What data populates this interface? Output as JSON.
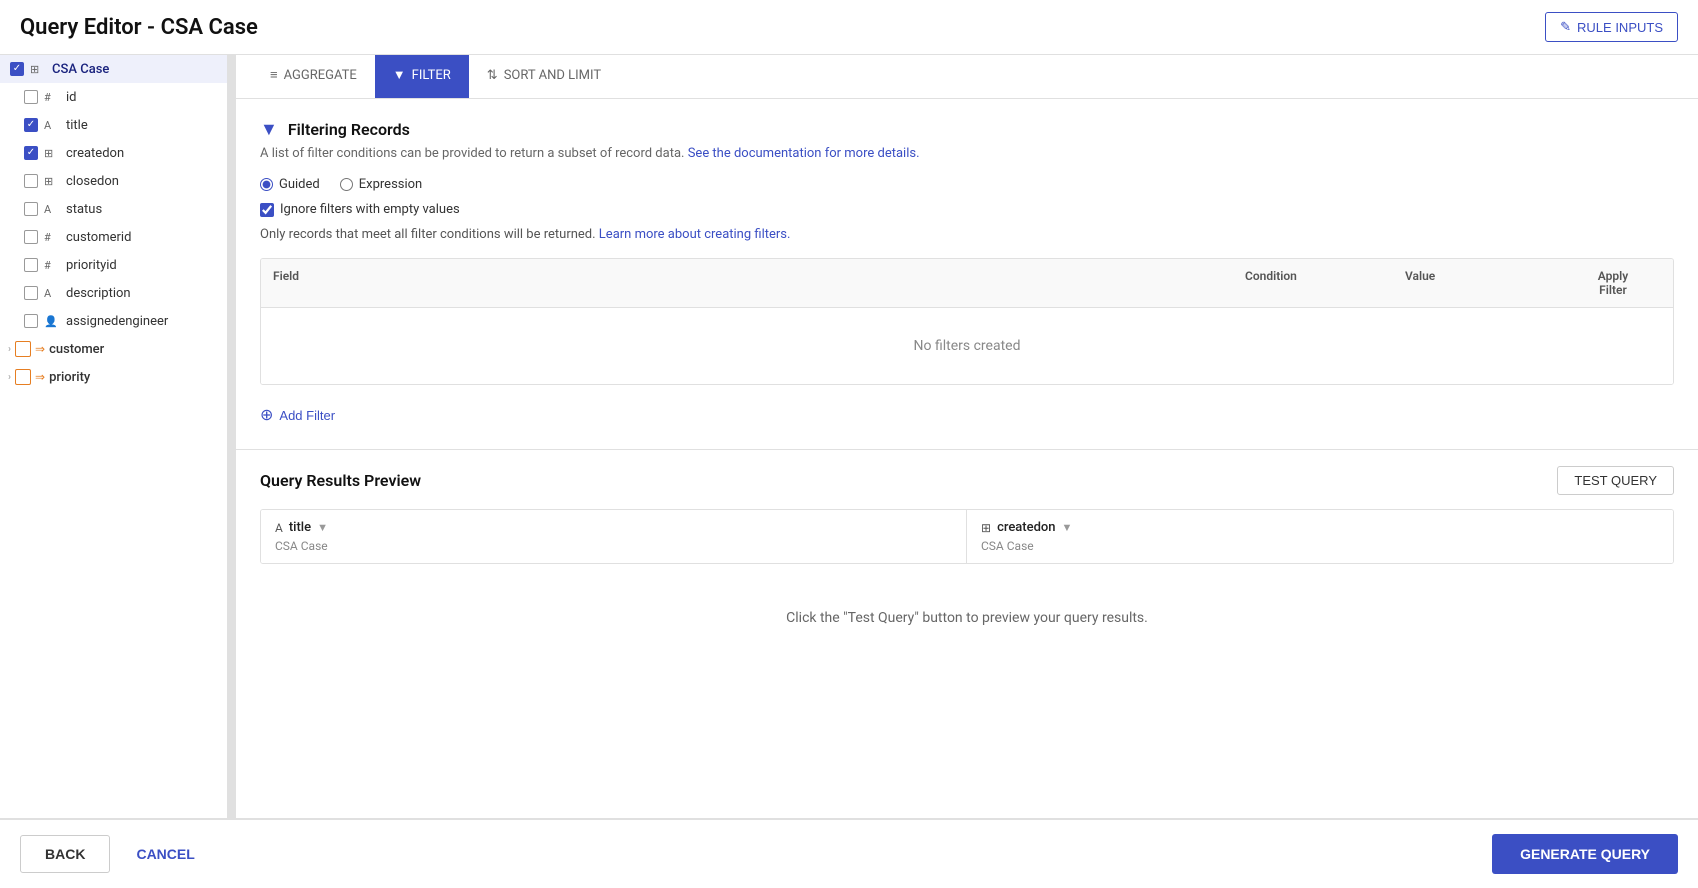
{
  "header": {
    "title": "Query Editor - CSA Case",
    "rule_inputs_label": "RULE INPUTS",
    "pencil_icon": "✎"
  },
  "sidebar": {
    "root_item": {
      "label": "CSA Case",
      "checked": true,
      "icon": "⊞"
    },
    "fields": [
      {
        "id": "id",
        "label": "id",
        "checked": false,
        "type": "#",
        "typeLabel": "#"
      },
      {
        "id": "title",
        "label": "title",
        "checked": true,
        "type": "A",
        "typeLabel": "A"
      },
      {
        "id": "createdon",
        "label": "createdon",
        "checked": true,
        "type": "⊞",
        "typeLabel": "⊞"
      },
      {
        "id": "closedon",
        "label": "closedon",
        "checked": false,
        "type": "⊞",
        "typeLabel": "⊞"
      },
      {
        "id": "status",
        "label": "status",
        "checked": false,
        "type": "A",
        "typeLabel": "A"
      },
      {
        "id": "customerid",
        "label": "customerid",
        "checked": false,
        "type": "#",
        "typeLabel": "#"
      },
      {
        "id": "priorityid",
        "label": "priorityid",
        "checked": false,
        "type": "#",
        "typeLabel": "#"
      },
      {
        "id": "description",
        "label": "description",
        "checked": false,
        "type": "A",
        "typeLabel": "A"
      },
      {
        "id": "assignedengineer",
        "label": "assignedengineer",
        "checked": false,
        "type": "👤",
        "typeLabel": "👤"
      }
    ],
    "groups": [
      {
        "id": "customer",
        "label": "customer"
      },
      {
        "id": "priority",
        "label": "priority"
      }
    ]
  },
  "tabs": [
    {
      "id": "aggregate",
      "label": "AGGREGATE",
      "icon": "≡",
      "active": false
    },
    {
      "id": "filter",
      "label": "FILTER",
      "icon": "▼",
      "active": true
    },
    {
      "id": "sort",
      "label": "SORT AND LIMIT",
      "icon": "⇅",
      "active": false
    }
  ],
  "filter_section": {
    "icon": "▼",
    "title": "Filtering Records",
    "description": "A list of filter conditions can be provided to return a subset of record data.",
    "doc_link": "See the documentation for more details.",
    "guided_label": "Guided",
    "expression_label": "Expression",
    "ignore_empty_label": "Ignore filters with empty values",
    "note_text": "Only records that meet all filter conditions will be returned.",
    "note_link": "Learn more about creating filters.",
    "table_headers": {
      "field": "Field",
      "condition": "Condition",
      "value": "Value",
      "apply": "Apply\nFilter"
    },
    "no_filters_msg": "No filters created",
    "add_filter_label": "+ Add Filter"
  },
  "results_section": {
    "title": "Query Results Preview",
    "test_query_label": "TEST QUERY",
    "columns": [
      {
        "type": "A",
        "name": "title",
        "sub": "CSA Case"
      },
      {
        "type": "⊞",
        "name": "createdon",
        "sub": "CSA Case"
      }
    ],
    "preview_msg": "Click the \"Test Query\" button to preview your query results."
  },
  "footer": {
    "back_label": "BACK",
    "cancel_label": "CANCEL",
    "generate_label": "GENERATE QUERY"
  }
}
